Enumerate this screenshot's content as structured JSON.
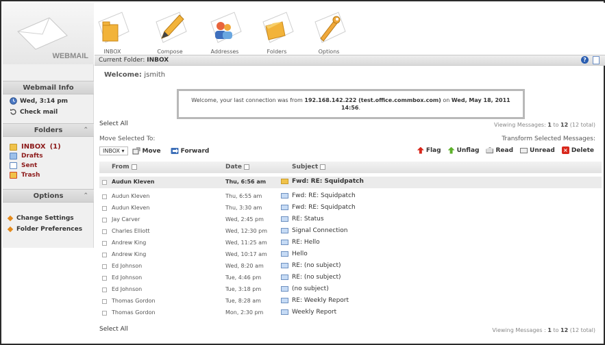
{
  "app": {
    "logo_text": "WEBMAIL"
  },
  "toolbar": {
    "items": [
      {
        "label": "INBOX",
        "icon": "inbox-folder-icon"
      },
      {
        "label": "Compose",
        "icon": "compose-pencil-icon"
      },
      {
        "label": "Addresses",
        "icon": "addresses-people-icon"
      },
      {
        "label": "Folders",
        "icon": "folders-icon"
      },
      {
        "label": "Options",
        "icon": "options-wrench-icon"
      }
    ]
  },
  "folderbar": {
    "prefix": "Current Folder:",
    "folder": "INBOX"
  },
  "sidebar": {
    "webmail_info_title": "Webmail Info",
    "datetime": "Wed, 3:14 pm",
    "check_mail": "Check mail",
    "folders_title": "Folders",
    "folders": [
      {
        "name": "INBOX",
        "count": "(1)"
      },
      {
        "name": "Drafts"
      },
      {
        "name": "Sent"
      },
      {
        "name": "Trash"
      }
    ],
    "options_title": "Options",
    "options": [
      "Change Settings",
      "Folder Preferences"
    ]
  },
  "welcome": {
    "label": "Welcome:",
    "user": "jsmith"
  },
  "last_connection": {
    "text_before": "Welcome, your last connection was from ",
    "ip": "192.168.142.222 (test.office.commbox.com)",
    "text_mid": " on ",
    "date": "Wed, May 18, 2011",
    "time": "14:56",
    "suffix": "."
  },
  "list": {
    "select_all": "Select All",
    "viewing_top": {
      "prefix": "Viewing Messages:",
      "from": "1",
      "to_word": "to",
      "to": "12",
      "total": "(12 total)"
    },
    "viewing_bottom": {
      "prefix": "Viewing Messages :",
      "from": "1",
      "to_word": "to",
      "to": "12",
      "total": "(12 total)"
    },
    "move_selected_label": "Move Selected To:",
    "transform_label": "Transform Selected Messages:",
    "move_folder_value": "INBOX",
    "move_button": "Move",
    "forward_button": "Forward",
    "actions": {
      "flag": "Flag",
      "unflag": "Unflag",
      "read": "Read",
      "unread": "Unread",
      "delete": "Delete"
    },
    "columns": {
      "from": "From",
      "date": "Date",
      "subject": "Subject"
    },
    "rows": [
      {
        "from": "Audun Kleven",
        "date": "Thu, 6:56 am",
        "subject": "Fwd: RE: Squidpatch"
      },
      {
        "from": "Audun Kleven",
        "date": "Thu, 6:55 am",
        "subject": "Fwd: RE: Squidpatch"
      },
      {
        "from": "Audun Kleven",
        "date": "Thu, 3:30 am",
        "subject": "Fwd: RE: Squidpatch"
      },
      {
        "from": "Jay Carver",
        "date": "Wed, 2:45 pm",
        "subject": "RE: Status"
      },
      {
        "from": "Charles Elliott",
        "date": "Wed, 12:30 pm",
        "subject": "Signal Connection"
      },
      {
        "from": "Andrew King",
        "date": "Wed, 11:25 am",
        "subject": "RE: Hello"
      },
      {
        "from": "Andrew King",
        "date": "Wed, 10:17 am",
        "subject": "Hello"
      },
      {
        "from": "Ed Johnson",
        "date": "Wed, 8:20 am",
        "subject": "RE: (no subject)"
      },
      {
        "from": "Ed Johnson",
        "date": "Tue, 4:46 pm",
        "subject": "RE: (no subject)"
      },
      {
        "from": "Ed Johnson",
        "date": "Tue, 3:18 pm",
        "subject": "(no subject)"
      },
      {
        "from": "Thomas Gordon",
        "date": "Tue, 8:28 am",
        "subject": "RE: Weekly Report"
      },
      {
        "from": "Thomas Gordon",
        "date": "Mon, 2:30 pm",
        "subject": "Weekly Report"
      }
    ]
  }
}
